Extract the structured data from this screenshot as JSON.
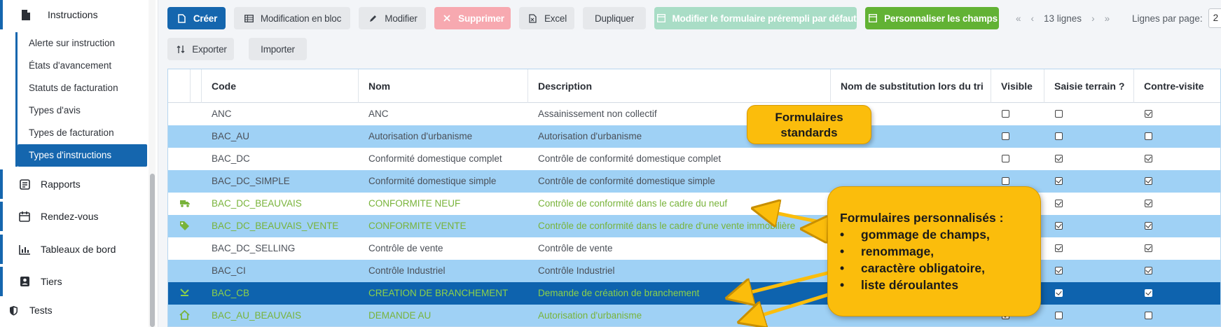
{
  "sidebar": {
    "section_title": "Instructions",
    "sub_items": [
      {
        "label": "Alerte sur instruction"
      },
      {
        "label": "États d'avancement"
      },
      {
        "label": "Statuts de facturation"
      },
      {
        "label": "Types d'avis"
      },
      {
        "label": "Types de facturation"
      },
      {
        "label": "Types d'instructions"
      }
    ],
    "groups": [
      {
        "label": "Rapports",
        "icon": "report-icon"
      },
      {
        "label": "Rendez-vous",
        "icon": "calendar-icon"
      },
      {
        "label": "Tableaux de bord",
        "icon": "bar-chart-icon"
      },
      {
        "label": "Tiers",
        "icon": "contact-icon"
      },
      {
        "label": "Tests",
        "icon": "shield-icon"
      }
    ]
  },
  "toolbar": {
    "create": "Créer",
    "bulk_edit": "Modification en bloc",
    "edit": "Modifier",
    "delete": "Supprimer",
    "excel": "Excel",
    "duplicate": "Dupliquer",
    "edit_default_form": "Modifier le formulaire prérempli par défaut",
    "customize_fields": "Personnaliser les champs",
    "export": "Exporter",
    "import": "Importer"
  },
  "pager": {
    "first": "«",
    "prev": "‹",
    "count": "13 lignes",
    "next": "›",
    "last": "»",
    "per_page_label": "Lignes par page:",
    "per_page_value": "2"
  },
  "grid": {
    "columns": [
      "Code",
      "Nom",
      "Description",
      "Nom de substitution lors du tri",
      "Visible",
      "Saisie terrain ?",
      "Contre-visite"
    ],
    "rows": [
      {
        "code": "ANC",
        "nom": "ANC",
        "description": "Assainissement non collectif",
        "visible": false,
        "saisie": false,
        "contre": true,
        "custom": false,
        "icon": ""
      },
      {
        "code": "BAC_AU",
        "nom": "Autorisation d'urbanisme",
        "description": "Autorisation d'urbanisme",
        "visible": false,
        "saisie": false,
        "contre": false,
        "custom": false,
        "icon": ""
      },
      {
        "code": "BAC_DC",
        "nom": "Conformité domestique complet",
        "description": "Contrôle de conformité domestique complet",
        "visible": false,
        "saisie": true,
        "contre": true,
        "custom": false,
        "icon": ""
      },
      {
        "code": "BAC_DC_SIMPLE",
        "nom": "Conformité domestique simple",
        "description": "Contrôle de conformité domestique simple",
        "visible": false,
        "saisie": true,
        "contre": true,
        "custom": false,
        "icon": ""
      },
      {
        "code": "BAC_DC_BEAUVAIS",
        "nom": "CONFORMITE NEUF",
        "description": "Contrôle de conformité dans le cadre du neuf",
        "visible": false,
        "saisie": true,
        "contre": true,
        "custom": true,
        "icon": "truck-icon"
      },
      {
        "code": "BAC_DC_BEAUVAIS_VENTE",
        "nom": "CONFORMITE VENTE",
        "description": "Contrôle de conformité dans le cadre d'une vente immobilière",
        "visible": false,
        "saisie": true,
        "contre": true,
        "custom": true,
        "icon": "tag-icon"
      },
      {
        "code": "BAC_DC_SELLING",
        "nom": "Contrôle de vente",
        "description": "Contrôle de vente",
        "visible": false,
        "saisie": true,
        "contre": true,
        "custom": false,
        "icon": ""
      },
      {
        "code": "BAC_CI",
        "nom": "Contrôle Industriel",
        "description": "Contrôle Industriel",
        "visible": false,
        "saisie": true,
        "contre": true,
        "custom": false,
        "icon": ""
      },
      {
        "code": "BAC_CB",
        "nom": "CREATION DE BRANCHEMENT",
        "description": "Demande de création de branchement",
        "visible": false,
        "saisie": true,
        "contre": true,
        "custom": true,
        "icon": "branch-icon"
      },
      {
        "code": "BAC_AU_BEAUVAIS",
        "nom": "DEMANDE AU",
        "description": "Autorisation d'urbanisme",
        "visible": true,
        "saisie": false,
        "contre": false,
        "custom": true,
        "icon": "house-icon"
      }
    ]
  },
  "callouts": {
    "standard": [
      "Formulaires",
      "standards"
    ],
    "custom_title": "Formulaires personnalisés :",
    "custom_items": [
      "gommage de champs,",
      "renommage,",
      "caractère obligatoire,",
      "liste déroulantes"
    ],
    "bullet": "•"
  },
  "colors": {
    "primary": "#1566ae",
    "row_alt": "#9fd1f5",
    "row_selected": "#0e63ae",
    "custom_text": "#78b33a",
    "callout": "#fbbd0c"
  }
}
